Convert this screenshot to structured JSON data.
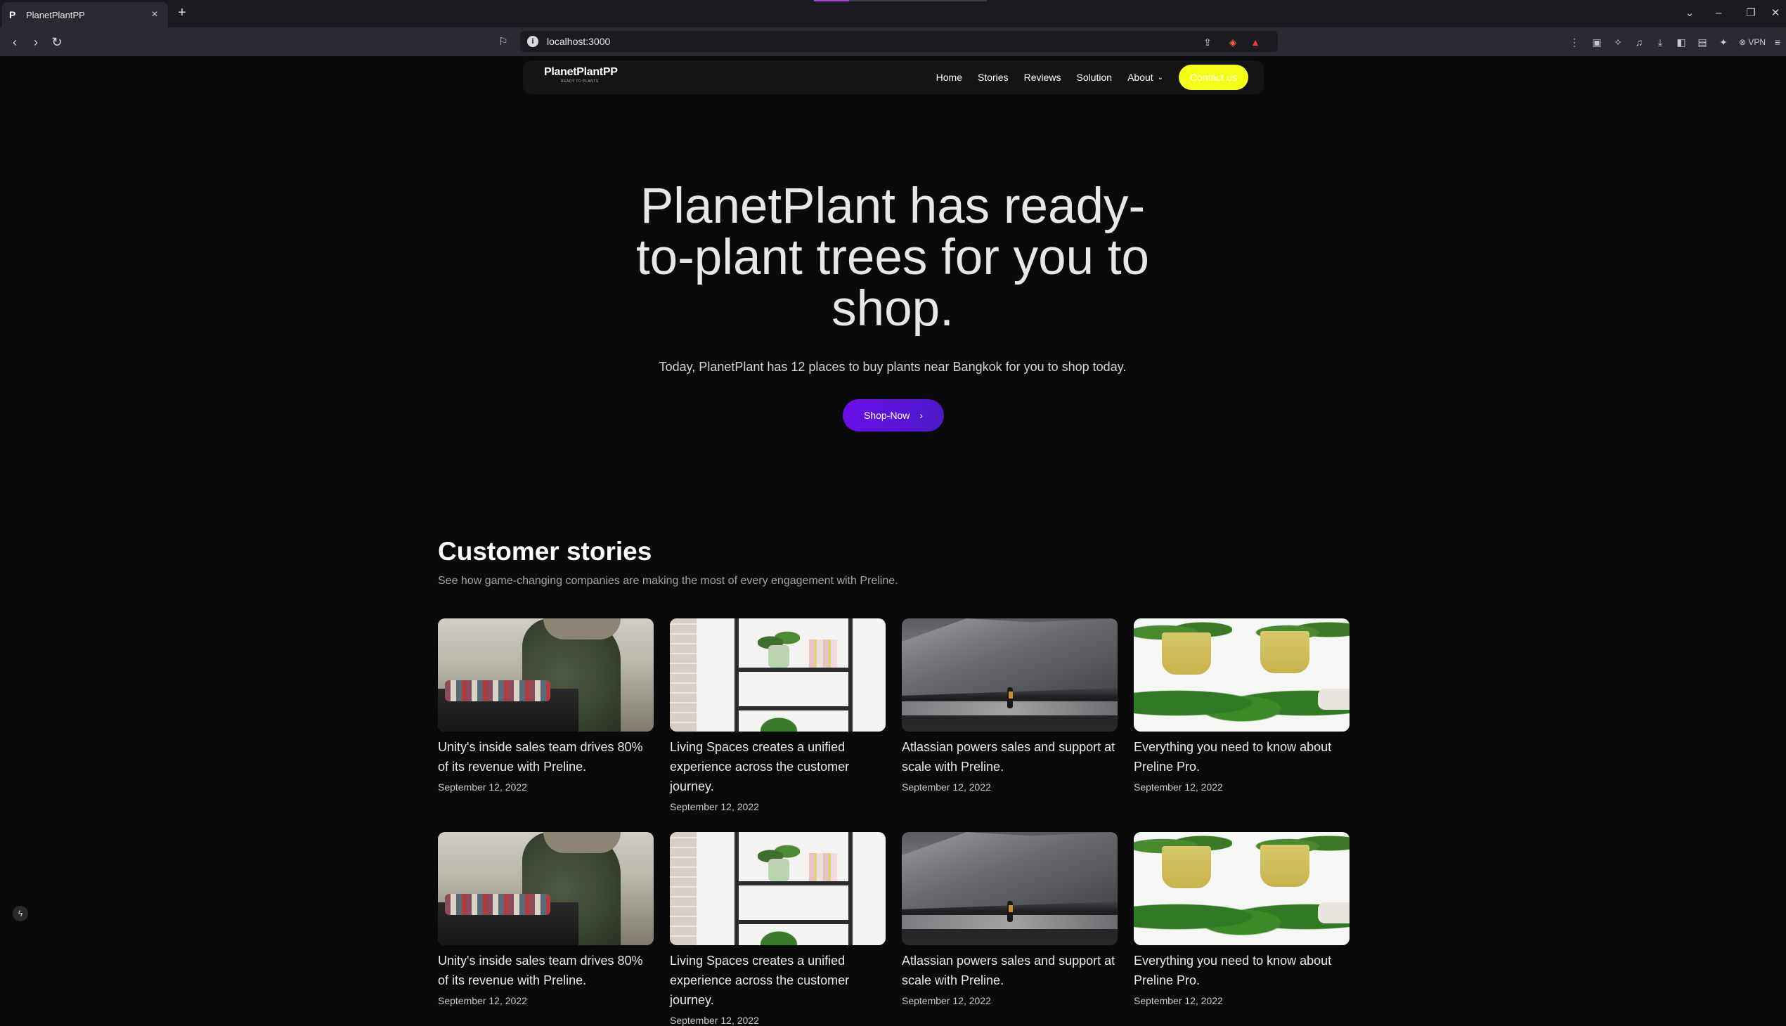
{
  "browser": {
    "tab_title": "PlanetPlantPP",
    "tab_favicon": "P",
    "tab_close": "×",
    "new_tab": "+",
    "url": "localhost:3000",
    "vpn_label": "VPN"
  },
  "header": {
    "logo": "PlanetPlantPP",
    "logo_tagline": "READY TO PLANTS",
    "nav": {
      "home": "Home",
      "stories": "Stories",
      "reviews": "Reviews",
      "solution": "Solution",
      "about": "About",
      "contact": "Contact us"
    }
  },
  "hero": {
    "title_line1": "PlanetPlant has ready-",
    "title_line2": "to-plant trees for you to",
    "title_line3": "shop.",
    "subtitle": "Today, PlanetPlant has 12 places to buy plants near Bangkok for you to shop today.",
    "cta": "Shop-Now"
  },
  "stories": {
    "title": "Customer stories",
    "subtitle": "See how game-changing companies are making the most of every engagement with Preline.",
    "cards": [
      {
        "title": "Unity's inside sales team drives 80% of its revenue with Preline.",
        "date": "September 12, 2022"
      },
      {
        "title": "Living Spaces creates a unified experience across the customer journey.",
        "date": "September 12, 2022"
      },
      {
        "title": "Atlassian powers sales and support at scale with Preline.",
        "date": "September 12, 2022"
      },
      {
        "title": "Everything you need to know about Preline Pro.",
        "date": "September 12, 2022"
      },
      {
        "title": "Unity's inside sales team drives 80% of its revenue with Preline.",
        "date": "September 12, 2022"
      },
      {
        "title": "Living Spaces creates a unified experience across the customer journey.",
        "date": "September 12, 2022"
      },
      {
        "title": "Atlassian powers sales and support at scale with Preline.",
        "date": "September 12, 2022"
      },
      {
        "title": "Everything you need to know about Preline Pro.",
        "date": "September 12, 2022"
      }
    ]
  },
  "colors": {
    "accent_button": "#f3ff14",
    "cta_gradient_start": "#6a0eea",
    "cta_gradient_end": "#4b1ac9",
    "page_background": "#0a0a0a"
  }
}
